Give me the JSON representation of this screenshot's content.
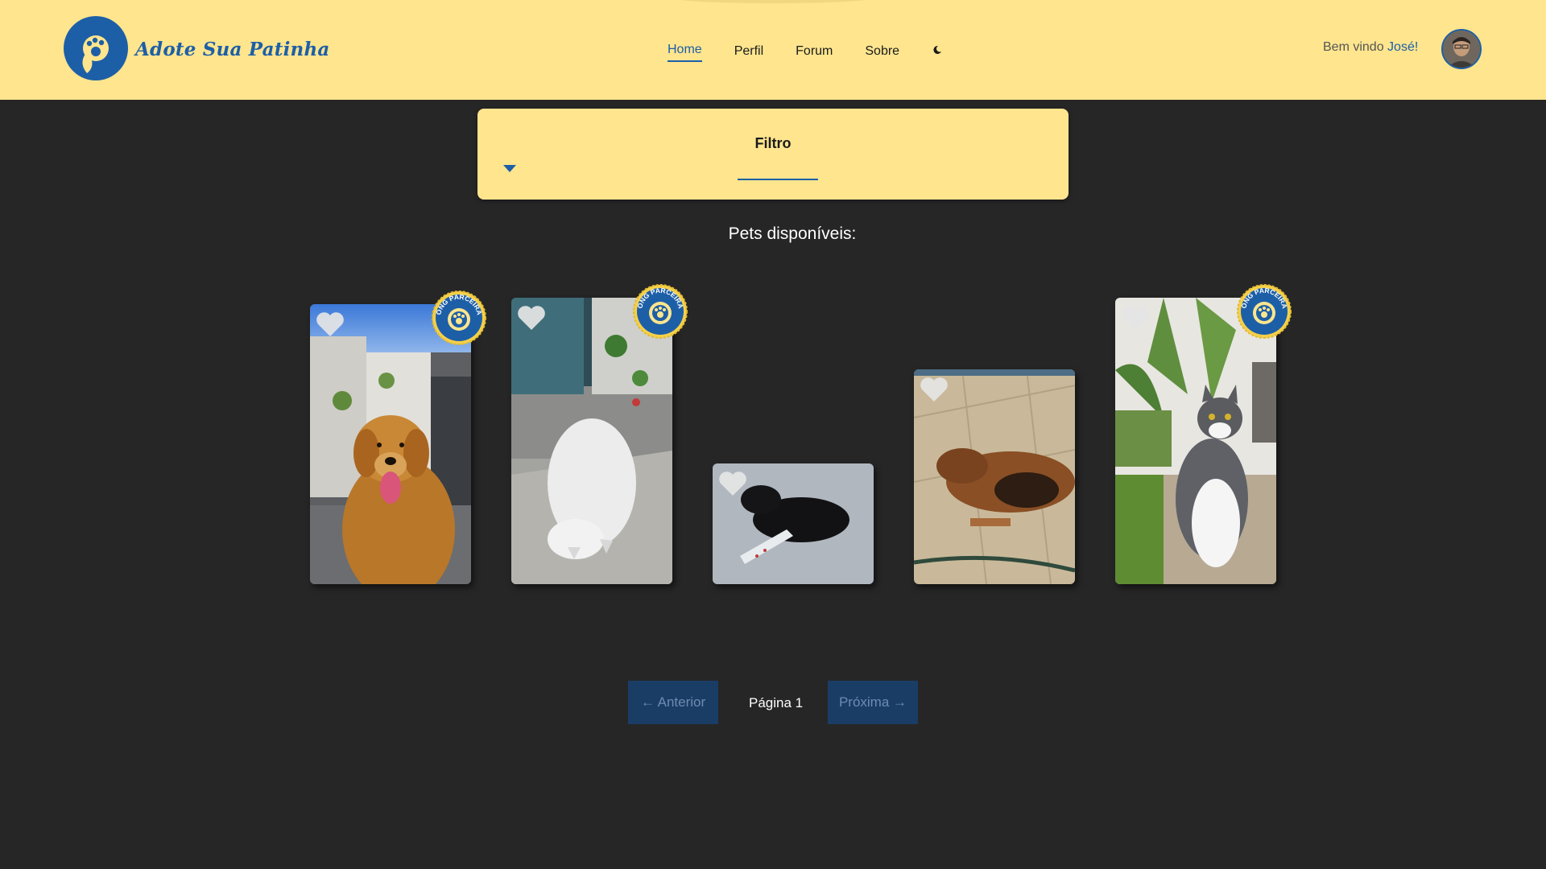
{
  "brand": {
    "name": "Adote Sua Patinha",
    "primary_color": "#1d5fa7",
    "header_bg": "#fee58e",
    "page_bg": "#262626"
  },
  "nav": {
    "items": [
      {
        "label": "Home",
        "active": true
      },
      {
        "label": "Perfil",
        "active": false
      },
      {
        "label": "Forum",
        "active": false
      },
      {
        "label": "Sobre",
        "active": false
      }
    ],
    "theme_toggle_icon": "moon-icon"
  },
  "user": {
    "welcome_prefix": "Bem vindo",
    "name": "José!"
  },
  "filter": {
    "title": "Filtro"
  },
  "pets": {
    "heading": "Pets disponíveis:",
    "badge_text": "ONG PARCEIRA",
    "cards": [
      {
        "photo": "golden retriever dog sitting",
        "ong_partner": true,
        "favorited": false
      },
      {
        "photo": "white cat lying upside down",
        "ong_partner": true,
        "favorited": false
      },
      {
        "photo": "black cat with bandaged leg",
        "ong_partner": false,
        "favorited": false
      },
      {
        "photo": "brown dog sleeping on tiles",
        "ong_partner": false,
        "favorited": false
      },
      {
        "photo": "grey and white cat sitting in garden",
        "ong_partner": true,
        "favorited": false
      }
    ]
  },
  "pagination": {
    "prev_label": "← Anterior",
    "page_label": "Página 1",
    "next_label": "Próxima →"
  }
}
